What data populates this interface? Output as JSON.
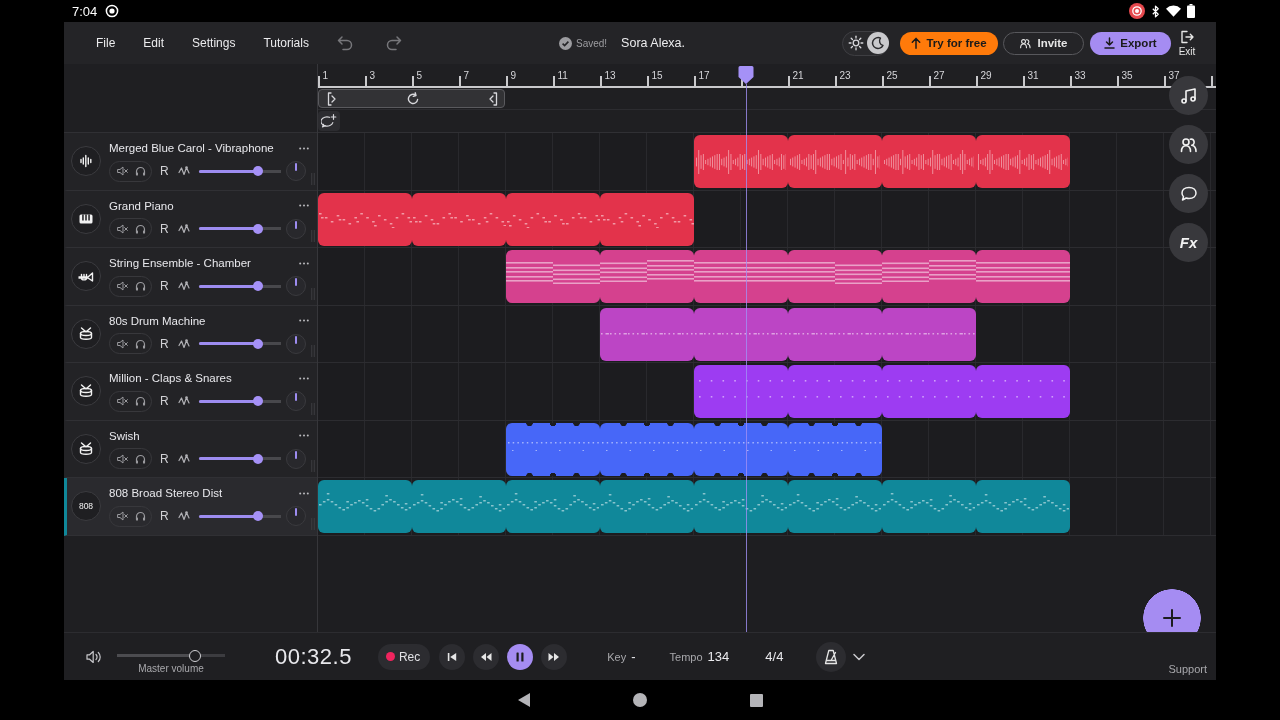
{
  "status_bar": {
    "time": "7:04"
  },
  "menu": [
    "File",
    "Edit",
    "Settings",
    "Tutorials"
  ],
  "undo": {
    "disabled": true
  },
  "redo": {
    "disabled": true
  },
  "save_status": "Saved!",
  "project_name": "Sora Alexa.",
  "theme": {
    "dark": true
  },
  "actions": [
    {
      "kind": "upgrade",
      "label": "Try for free"
    },
    {
      "kind": "invite",
      "label": "Invite"
    },
    {
      "kind": "export",
      "label": "Export"
    }
  ],
  "exit": {
    "label": "Exit"
  },
  "ruler": [
    {
      "kind": "labelled",
      "label": "1"
    },
    {
      "kind": "labelled",
      "label": "3"
    },
    {
      "kind": "labelled",
      "label": "5"
    },
    {
      "kind": "labelled",
      "label": "7"
    },
    {
      "kind": "labelled",
      "label": "9"
    },
    {
      "kind": "labelled",
      "label": "11"
    },
    {
      "kind": "labelled",
      "label": "13"
    },
    {
      "kind": "labelled",
      "label": "15"
    },
    {
      "kind": "labelled",
      "label": "17"
    },
    {
      "kind": "plain"
    },
    {
      "kind": "labelled",
      "label": "21"
    },
    {
      "kind": "labelled",
      "label": "23"
    },
    {
      "kind": "labelled",
      "label": "25"
    },
    {
      "kind": "labelled",
      "label": "27"
    },
    {
      "kind": "labelled",
      "label": "29"
    },
    {
      "kind": "labelled",
      "label": "31"
    },
    {
      "kind": "labelled",
      "label": "33"
    },
    {
      "kind": "labelled",
      "label": "35"
    },
    {
      "kind": "labelled",
      "label": "37"
    },
    {
      "kind": "plain"
    }
  ],
  "playhead": {
    "level": 0.477
  },
  "tracks": [
    {
      "name": "Merged Blue Carol - Vibraphone",
      "icon": {
        "kind": "waveform"
      },
      "color": "#e3334b",
      "selected": false,
      "arm_label": "R",
      "volume": {
        "level": 0.72
      },
      "pan": {
        "level": 0.5
      },
      "kind": "audio",
      "slots": [
        false,
        false,
        false,
        false,
        true,
        true,
        true,
        true
      ]
    },
    {
      "name": "Grand Piano",
      "icon": {
        "kind": "piano"
      },
      "color": "#e3334b",
      "selected": false,
      "arm_label": "R",
      "volume": {
        "level": 0.72
      },
      "pan": {
        "level": 0.5
      },
      "kind": "chords",
      "slots": [
        true,
        true,
        true,
        true,
        false,
        false,
        false,
        false
      ]
    },
    {
      "name": "String Ensemble - Chamber",
      "icon": {
        "kind": "trumpet"
      },
      "color": "#d5418e",
      "selected": false,
      "arm_label": "R",
      "volume": {
        "level": 0.72
      },
      "pan": {
        "level": 0.5
      },
      "kind": "strings",
      "slots": [
        false,
        false,
        true,
        true,
        true,
        true,
        true,
        true
      ]
    },
    {
      "name": "80s Drum Machine",
      "icon": {
        "kind": "drum"
      },
      "color": "#bc45c5",
      "selected": false,
      "arm_label": "R",
      "volume": {
        "level": 0.72
      },
      "pan": {
        "level": 0.5
      },
      "kind": "drums",
      "slots": [
        false,
        false,
        false,
        true,
        true,
        true,
        true,
        false
      ]
    },
    {
      "name": "Million - Claps & Snares",
      "icon": {
        "kind": "drum"
      },
      "color": "#9d3cf2",
      "selected": false,
      "arm_label": "R",
      "volume": {
        "level": 0.72
      },
      "pan": {
        "level": 0.5
      },
      "kind": "claps",
      "slots": [
        false,
        false,
        false,
        false,
        true,
        true,
        true,
        true
      ]
    },
    {
      "name": "Swish",
      "icon": {
        "kind": "drum"
      },
      "color": "#4767f8",
      "selected": false,
      "arm_label": "R",
      "volume": {
        "level": 0.72
      },
      "pan": {
        "level": 0.5
      },
      "kind": "hits",
      "slots": [
        false,
        false,
        true,
        true,
        true,
        true,
        false,
        false
      ]
    },
    {
      "name": "808 Broad Stereo Dist",
      "icon": {
        "kind": "label",
        "text": "808"
      },
      "color": "#10889a",
      "selected": true,
      "arm_label": "R",
      "volume": {
        "level": 0.72
      },
      "pan": {
        "level": 0.5
      },
      "kind": "bass",
      "slots": [
        true,
        true,
        true,
        true,
        true,
        true,
        true,
        true
      ]
    }
  ],
  "side_tools": [
    {
      "kind": "notes"
    },
    {
      "kind": "collaborators"
    },
    {
      "kind": "chat"
    },
    {
      "kind": "effects",
      "label": "Fx"
    }
  ],
  "transport": {
    "master_volume": {
      "label": "Master volume",
      "level": 0.72
    },
    "time": "00:32.5",
    "record_label": "Rec",
    "playing": true,
    "key": {
      "label": "Key",
      "value": "-"
    },
    "tempo": {
      "label": "Tempo",
      "value": "134"
    },
    "time_signature": "4/4"
  },
  "support": "Support"
}
